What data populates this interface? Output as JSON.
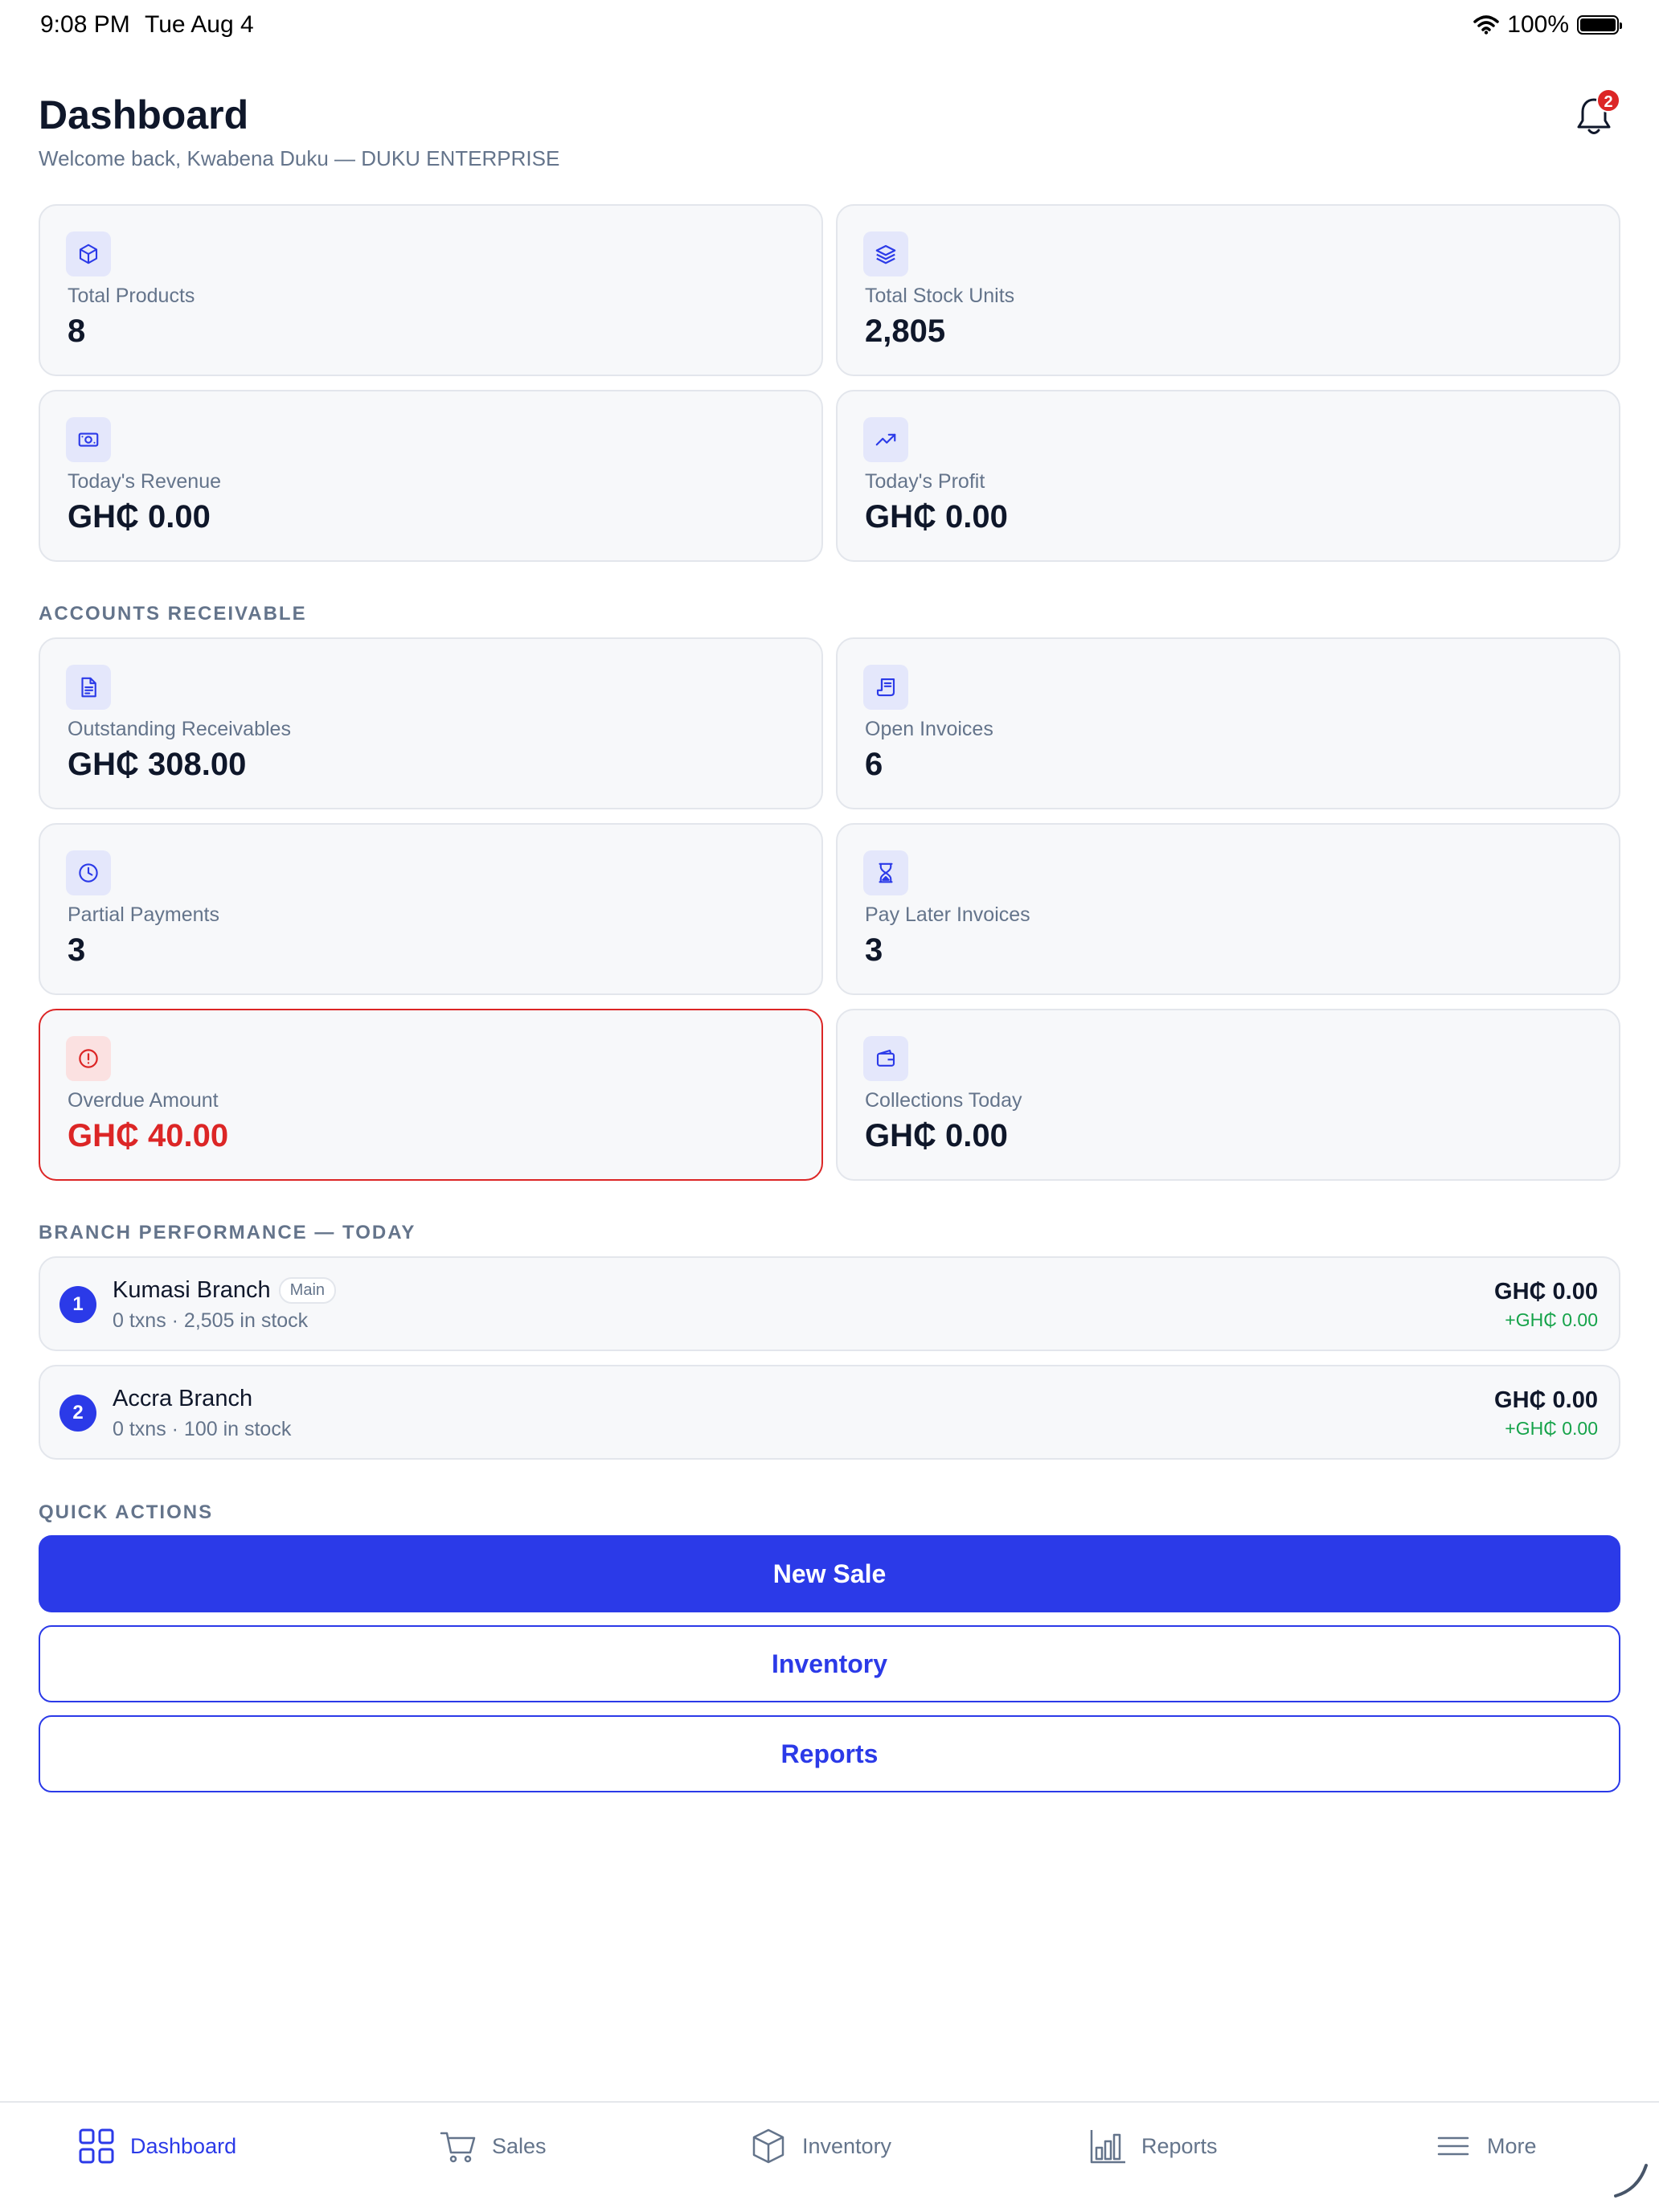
{
  "status": {
    "time": "9:08 PM",
    "date": "Tue Aug 4",
    "battery": "100%"
  },
  "header": {
    "title": "Dashboard",
    "subtitle": "Welcome back, Kwabena Duku — DUKU ENTERPRISE",
    "notification_count": "2"
  },
  "stats": [
    {
      "label": "Total Products",
      "value": "8",
      "icon": "cube-icon"
    },
    {
      "label": "Total Stock Units",
      "value": "2,805",
      "icon": "layers-icon"
    },
    {
      "label": "Today's Revenue",
      "value": "GH₵ 0.00",
      "icon": "cash-icon"
    },
    {
      "label": "Today's Profit",
      "value": "GH₵ 0.00",
      "icon": "trend-up-icon"
    }
  ],
  "receivables": {
    "section_label": "ACCOUNTS RECEIVABLE",
    "cards": [
      {
        "label": "Outstanding Receivables",
        "value": "GH₵ 308.00",
        "icon": "document-icon"
      },
      {
        "label": "Open Invoices",
        "value": "6",
        "icon": "receipt-icon"
      },
      {
        "label": "Partial Payments",
        "value": "3",
        "icon": "clock-icon"
      },
      {
        "label": "Pay Later Invoices",
        "value": "3",
        "icon": "hourglass-icon"
      },
      {
        "label": "Overdue Amount",
        "value": "GH₵ 40.00",
        "icon": "alert-icon",
        "status_color": "#dc2626"
      },
      {
        "label": "Collections Today",
        "value": "GH₵ 0.00",
        "icon": "wallet-icon"
      }
    ]
  },
  "branches": {
    "section_label": "BRANCH PERFORMANCE — TODAY",
    "items": [
      {
        "rank": "1",
        "name": "Kumasi Branch",
        "tag": "Main",
        "meta": "0 txns · 2,505 in stock",
        "amount": "GH₵ 0.00",
        "profit": "+GH₵ 0.00"
      },
      {
        "rank": "2",
        "name": "Accra Branch",
        "tag": "",
        "meta": "0 txns · 100 in stock",
        "amount": "GH₵ 0.00",
        "profit": "+GH₵ 0.00"
      }
    ]
  },
  "quick_actions": {
    "section_label": "QUICK ACTIONS",
    "new_sale": "New Sale",
    "inventory": "Inventory",
    "reports": "Reports"
  },
  "tabbar": [
    {
      "label": "Dashboard",
      "icon": "grid-icon",
      "active": true
    },
    {
      "label": "Sales",
      "icon": "cart-icon"
    },
    {
      "label": "Inventory",
      "icon": "box-icon"
    },
    {
      "label": "Reports",
      "icon": "bar-chart-icon"
    },
    {
      "label": "More",
      "icon": "menu-icon"
    }
  ],
  "colors": {
    "accent": "#2b3ae8",
    "danger": "#dc2626",
    "success": "#16a34a",
    "muted": "#64748b"
  }
}
